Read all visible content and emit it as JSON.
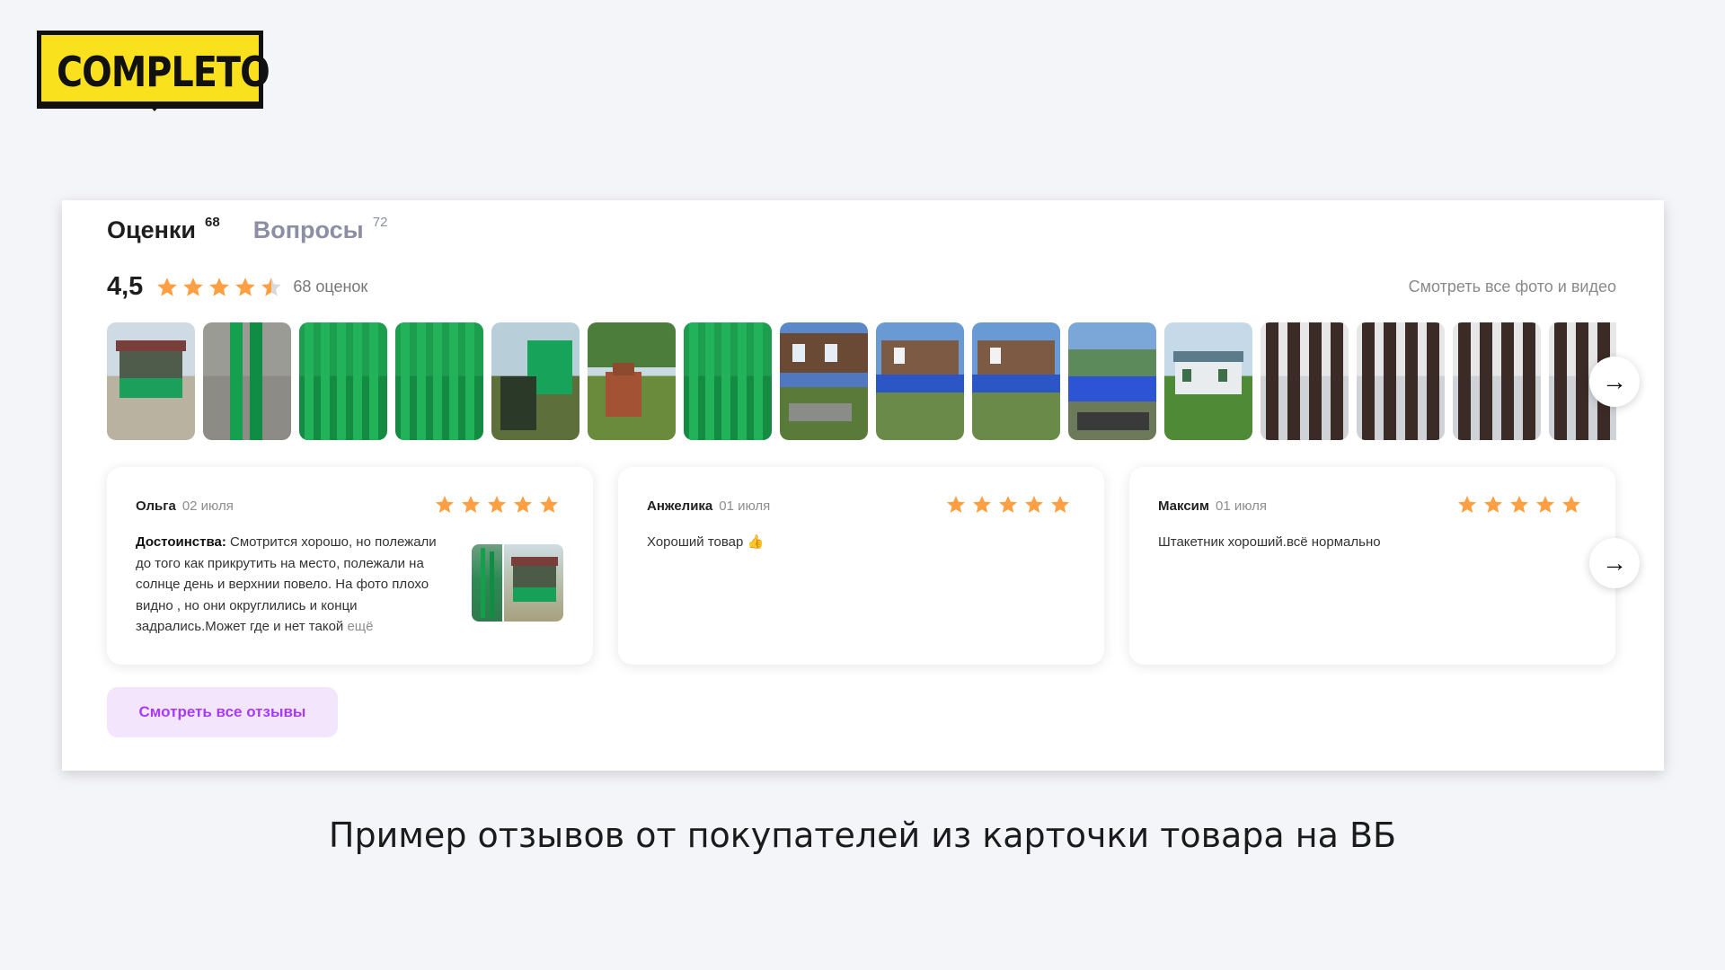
{
  "logo": {
    "text": "COMPLETO",
    "bg_color": "#f9e11e"
  },
  "tabs": [
    {
      "label": "Оценки",
      "count": "68",
      "active": true
    },
    {
      "label": "Вопросы",
      "count": "72",
      "active": false
    }
  ],
  "rating": {
    "value": "4,5",
    "stars_value": 4.5,
    "stars_max": 5,
    "count_label": "68 оценок",
    "see_all_media": "Смотреть все фото и видео",
    "star_color": "#ff9f43"
  },
  "photos": [
    {
      "icon": "gazebo-photo"
    },
    {
      "icon": "green-pickets-photo"
    },
    {
      "icon": "green-fence-photo"
    },
    {
      "icon": "green-fence-photo"
    },
    {
      "icon": "fence-garden-photo"
    },
    {
      "icon": "brick-oven-photo"
    },
    {
      "icon": "green-fence-photo"
    },
    {
      "icon": "house-fence-photo"
    },
    {
      "icon": "house-blue-fence-photo"
    },
    {
      "icon": "house-blue-fence-photo"
    },
    {
      "icon": "blue-fence-photo"
    },
    {
      "icon": "white-house-photo"
    },
    {
      "icon": "brown-fence-photo"
    },
    {
      "icon": "brown-fence-photo"
    },
    {
      "icon": "brown-fence-photo"
    },
    {
      "icon": "brown-fence-photo"
    }
  ],
  "reviews": [
    {
      "author": "Ольга",
      "date": "02 июля",
      "stars": 5,
      "text_label": "Достоинства:",
      "text": "Смотрится хорошо, но полежали до того как прикрутить на место, полежали на солнце день и верхнии повело. На фото плохо видно , но они округлились и конци задрались.Может где и нет такой",
      "more": "ещё",
      "has_photos": true
    },
    {
      "author": "Анжелика",
      "date": "01 июля",
      "stars": 5,
      "text_label": "",
      "text": "Хороший товар 👍",
      "more": "",
      "has_photos": false
    },
    {
      "author": "Максим",
      "date": "01 июля",
      "stars": 5,
      "text_label": "",
      "text": "Штакетник хороший.всё нормально",
      "more": "",
      "has_photos": false
    }
  ],
  "see_all_reviews": "Смотреть все отзывы",
  "caption": "Пример отзывов от покупателей из карточки товара на ВБ"
}
